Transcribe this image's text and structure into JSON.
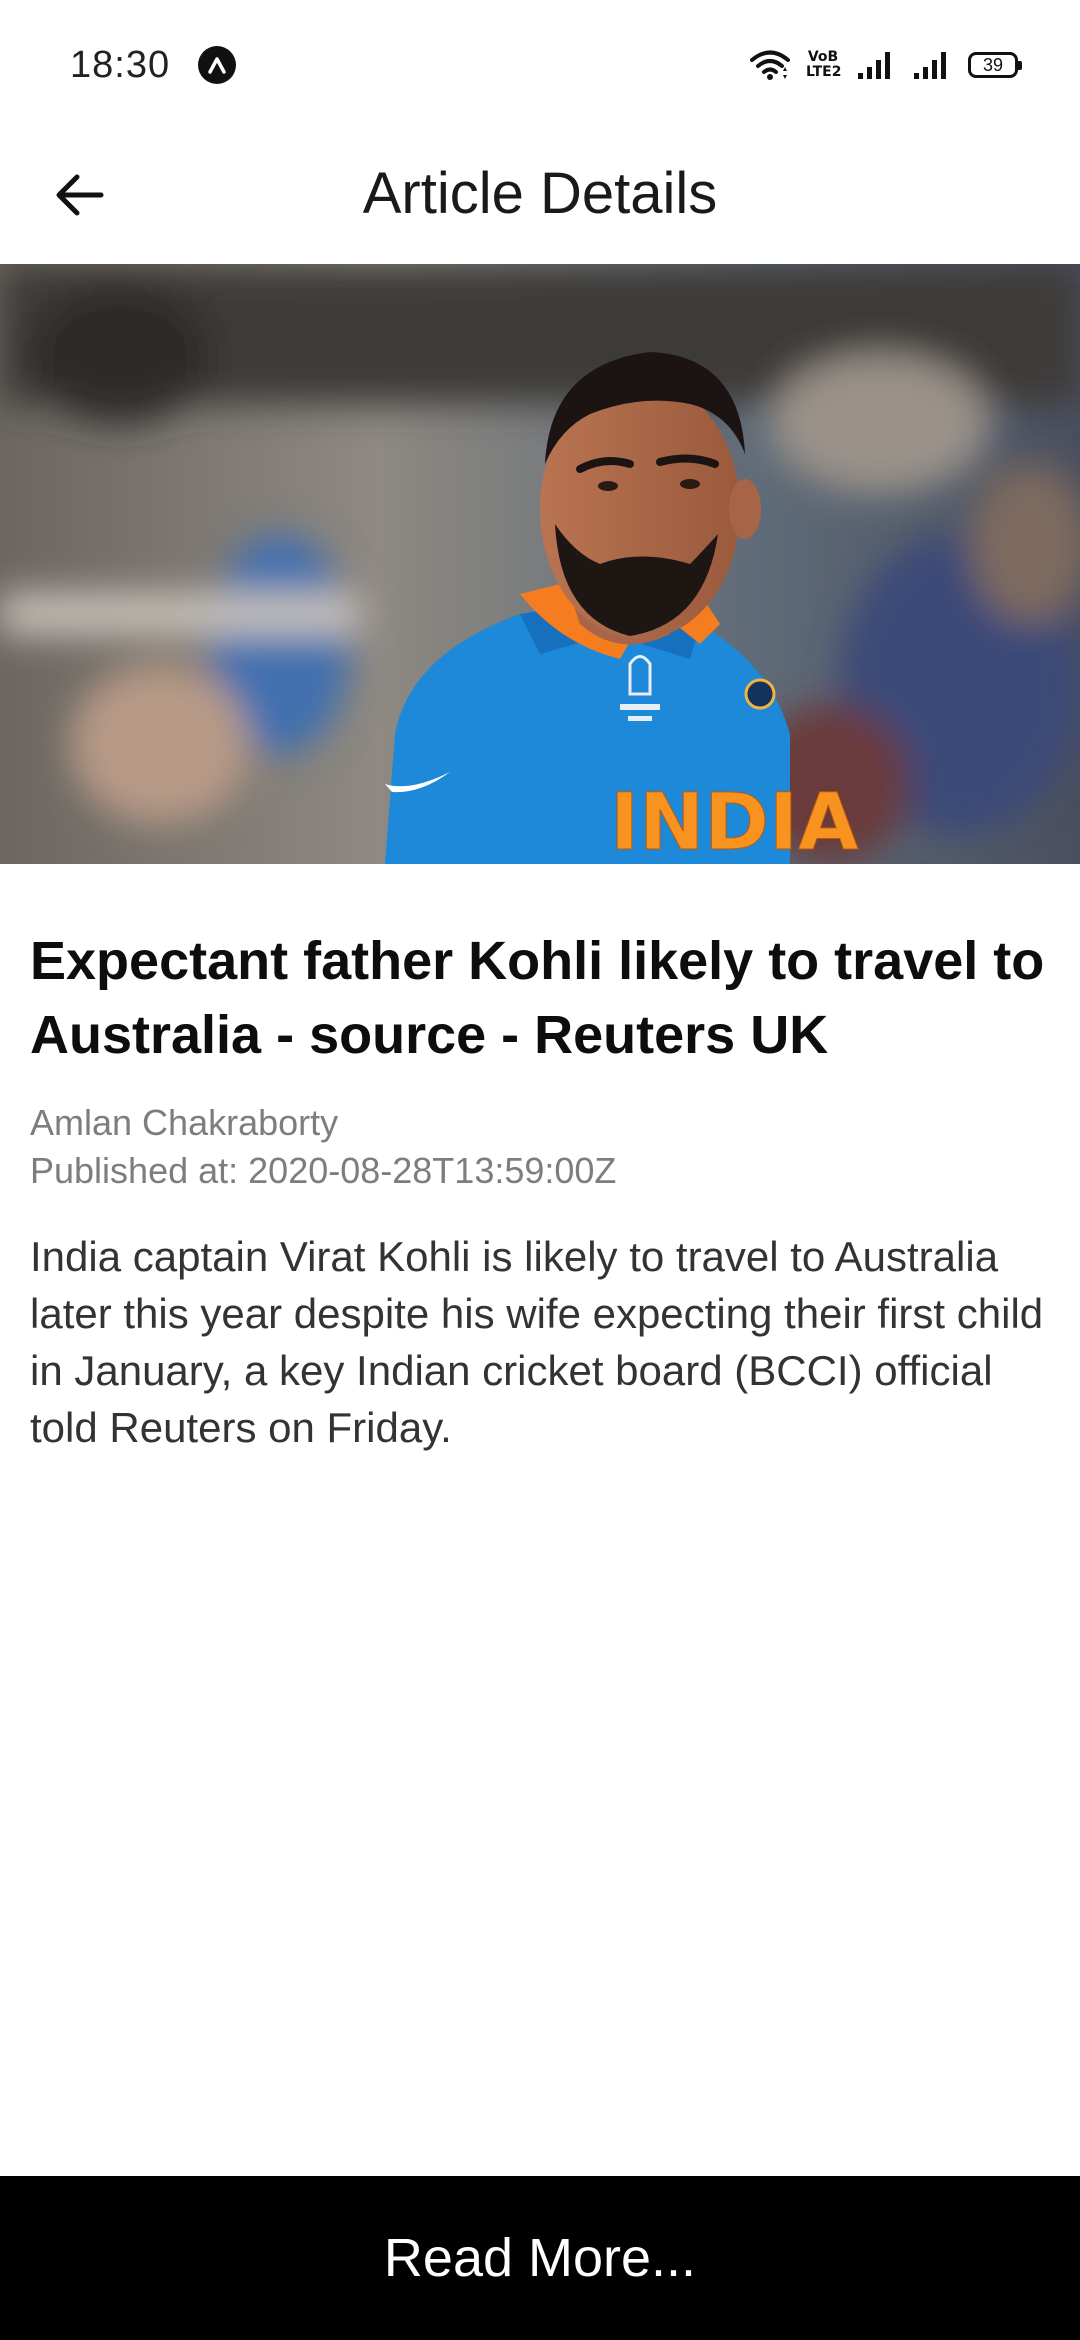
{
  "status_bar": {
    "time": "18:30",
    "volte_top": "VoB",
    "volte_bottom": "LTE2",
    "battery": "39"
  },
  "app_bar": {
    "title": "Article Details",
    "back_icon": "arrow-left-icon"
  },
  "article": {
    "headline": "Expectant father Kohli likely to travel to Australia - source - Reuters UK",
    "author": "Amlan Chakraborty",
    "published_label": "Published at:",
    "published_value": "2020-08-28T13:59:00Z",
    "description": "India captain Virat Kohli is likely to travel to Australia later this year despite his wife expecting their first child in January, a key Indian cricket board (BCCI) official told Reuters on Friday.",
    "image_jersey_text": "INDIA"
  },
  "footer": {
    "read_more_label": "Read More..."
  },
  "colors": {
    "jersey_blue": "#1e88d9",
    "collar_orange": "#f57c1f",
    "footer_bg": "#000000",
    "meta_text": "#7d7d7d"
  }
}
